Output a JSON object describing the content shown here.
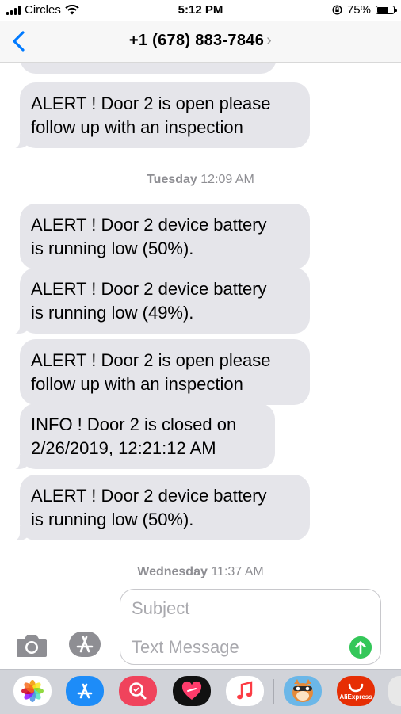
{
  "status_bar": {
    "carrier": "Circles",
    "time": "5:12 PM",
    "battery_percent": "75%",
    "battery_level": 0.75
  },
  "header": {
    "contact": "+1 (678) 883-7846",
    "chevron": "›"
  },
  "messages": [
    {
      "type": "received",
      "text": "ALERT ! Door 2 is open please\nfollow up with an inspection"
    },
    {
      "type": "timestamp",
      "day": "Tuesday",
      "time": "12:09 AM"
    },
    {
      "type": "received",
      "text": "ALERT ! Door 2 device battery\nis running low (50%)."
    },
    {
      "type": "received",
      "text": "ALERT ! Door 2 device battery\nis running low (49%)."
    },
    {
      "type": "received",
      "text": "ALERT ! Door 2 is open please\nfollow up with an inspection"
    },
    {
      "type": "received",
      "text": "INFO ! Door 2 is closed on\n2/26/2019, 12:21:12 AM"
    },
    {
      "type": "received",
      "text": "ALERT ! Door 2 device battery\nis running low (50%)."
    },
    {
      "type": "timestamp",
      "day": "Wednesday",
      "time": "11:37 AM"
    }
  ],
  "composer": {
    "subject_placeholder": "Subject",
    "message_placeholder": "Text Message"
  },
  "icons": {
    "back": "chevron-left-icon",
    "camera": "camera-icon",
    "app_store": "app-store-icon",
    "send": "send-arrow-icon"
  },
  "dock": {
    "apps": [
      "photos",
      "app-store",
      "image-search",
      "heart-app",
      "music",
      "game-character",
      "aliexpress"
    ],
    "aliexpress_label": "AliExpress"
  },
  "colors": {
    "accent": "#007aff",
    "bubble": "#e5e5ea",
    "send": "#34c759"
  }
}
